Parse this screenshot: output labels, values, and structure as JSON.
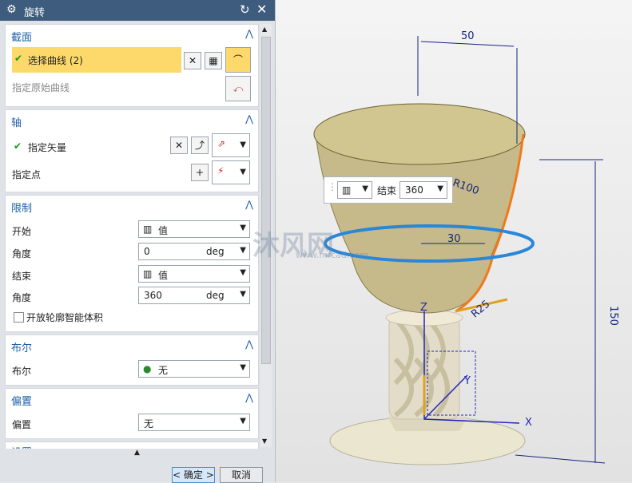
{
  "window": {
    "title": "旋转"
  },
  "sections": {
    "section": {
      "header": "截面",
      "select_curve": "选择曲线 (2)",
      "specify_original": "指定原始曲线"
    },
    "axis": {
      "header": "轴",
      "specify_vector": "指定矢量",
      "specify_point": "指定点"
    },
    "limits": {
      "header": "限制",
      "start_label": "开始",
      "start_value": "值",
      "start_angle_label": "角度",
      "start_angle": "0",
      "start_unit": "deg",
      "end_label": "结束",
      "end_value": "值",
      "end_angle_label": "角度",
      "end_angle": "360",
      "end_unit": "deg",
      "open_profile": "开放轮廓智能体积"
    },
    "boolean": {
      "header": "布尔",
      "label": "布尔",
      "value": "无"
    },
    "offset": {
      "header": "偏置",
      "label": "偏置",
      "value": "无"
    },
    "settings": {
      "header": "设置"
    }
  },
  "buttons": {
    "ok": "< 确定 >",
    "cancel": "取消"
  },
  "viewport": {
    "overlay": {
      "end_label": "结束",
      "end_value": "360"
    },
    "dimensions": {
      "d50": "50",
      "r100": "R100",
      "d30": "30",
      "r25": "R25",
      "d150": "150"
    },
    "axes": {
      "x": "X",
      "y": "Y",
      "z": "Z"
    },
    "watermark": {
      "logo": "沐风网",
      "url": "www.mfcad.com"
    }
  },
  "colors": {
    "titlebar": "#3e5d7e",
    "highlight": "#fcd96a",
    "accent": "#1f5fa8",
    "check": "#1a9a1a",
    "cup": "#c6ba8a"
  },
  "icons": [
    "gear-icon",
    "reset-icon",
    "close-icon",
    "check-icon",
    "curve-icon",
    "vector-icon",
    "point-icon",
    "value-icon",
    "boolean-icon"
  ]
}
